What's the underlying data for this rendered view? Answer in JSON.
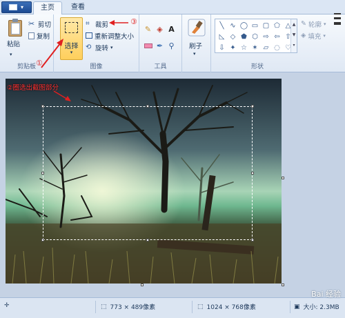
{
  "tabs": {
    "home": "主页",
    "view": "查看"
  },
  "clipboard": {
    "paste": "粘贴",
    "cut": "剪切",
    "copy": "复制",
    "label": "剪贴板"
  },
  "image": {
    "select": "选择",
    "crop": "裁剪",
    "resize": "重新调整大小",
    "rotate": "旋转",
    "label": "图像"
  },
  "tools": {
    "label": "工具"
  },
  "brushes": {
    "label": "刷子"
  },
  "shapes": {
    "outline": "轮廓",
    "fill": "填充",
    "label": "形状"
  },
  "annotations": {
    "marker1": "①",
    "marker3": "③",
    "note": "②圈选出截图部分"
  },
  "status": {
    "selection_size": "773 × 489像素",
    "image_size": "1024 × 768像素",
    "file_size": "大小: 2.3MB"
  },
  "watermark": "Bai 经验",
  "colors": {
    "accent": "#ffcf5c",
    "ribbon": "#dfe8f4",
    "annotation": "#e03030"
  }
}
